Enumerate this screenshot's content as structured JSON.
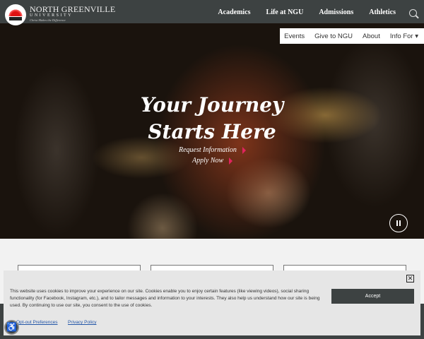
{
  "brand": {
    "name": "NORTH GREENVILLE",
    "sub": "UNIVERSITY",
    "tagline": "Christ Makes the Difference"
  },
  "nav": {
    "main": [
      "Academics",
      "Life at NGU",
      "Admissions",
      "Athletics"
    ],
    "secondary": [
      "Events",
      "Give to NGU",
      "About",
      "Info For ▾"
    ]
  },
  "hero": {
    "line1": "Your Journey",
    "line2": "Starts Here",
    "cta1": "Request Information",
    "cta2": "Apply Now"
  },
  "cookie": {
    "text": "This website uses cookies to improve your experience on our site. Cookies enable you to enjoy certain features (like viewing videos), social sharing functionality (for Facebook, Instagram, etc.), and to tailor messages and information to your interests. They also help us understand how our site is being used. By continuing to use our site, you consent to the use of cookies.",
    "accept": "Accept",
    "close": "✕",
    "optout": "Opt-out Preferences",
    "privacy": "Privacy Policy"
  },
  "a11y_icon": "♿"
}
